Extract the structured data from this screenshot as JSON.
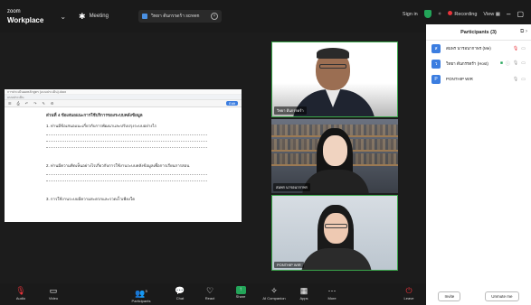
{
  "topbar": {
    "brand_line1": "zoom",
    "brand_line2": "Workplace",
    "meeting_label": "Meeting",
    "share_text": "วิทยา ต้นกรรดร้า screen",
    "sign_in": "Sign in",
    "recording": "Recording",
    "view": "View"
  },
  "shared_screen": {
    "title_bar": "การประเมินผลหลักสูตร (แบบประเมิน).docx",
    "tab_bar": "แบบประเมิน",
    "toolbar_items": [
      "☰",
      "⎙",
      "↶",
      "↷",
      "✎",
      "⚙"
    ],
    "toolbar_right": "Edit",
    "section": "ส่วนที่ 4 ข้อเสนอแนะการใช้บริการของระบบคลังข้อมูล",
    "q1": "1. ท่านมีข้อเสนอแนะเกี่ยวกับการพัฒนาและปรับปรุงระบบอย่างไร",
    "q2": "2. ท่านมีความคิดเห็นอย่างไรเกี่ยวกับการใช้งานระบบคลังข้อมูลเพื่อการเรียนการสอน",
    "q3": "3. การใช้งานระบบมีความสะดวกและรวดเร็วเพียงใด"
  },
  "tiles": [
    {
      "name": "วิทยา ต้นกรรดร้า"
    },
    {
      "name": "สมพร นารอนากาพร"
    },
    {
      "name": "PONTHIP WIR"
    }
  ],
  "participants": {
    "header": "Participants (3)",
    "rows": [
      {
        "avatar": "ส",
        "avatar_color": "#3b7de0",
        "name": "สมพร นารอนากาพร (Me)"
      },
      {
        "avatar": "ว",
        "avatar_color": "#3b7de0",
        "name": "วิทยา ต้นกรรดร้า (Host)"
      },
      {
        "avatar": "P",
        "avatar_color": "#3b7de0",
        "name": "PONTHIP WIR"
      }
    ],
    "invite": "Invite",
    "unmute_me": "Unmute me"
  },
  "toolbar": {
    "audio": "Audio",
    "video": "Video",
    "participants": "Participants",
    "participants_count": "3",
    "chat": "Chat",
    "react": "React",
    "share": "Share",
    "ai_companion": "AI Companion",
    "apps": "Apps",
    "more": "More",
    "leave": "Leave"
  },
  "colors": {
    "accent_blue": "#3b7de0",
    "speaker_border": "#3aa64a",
    "leave_red": "#e8333a",
    "share_green": "#23a559"
  }
}
